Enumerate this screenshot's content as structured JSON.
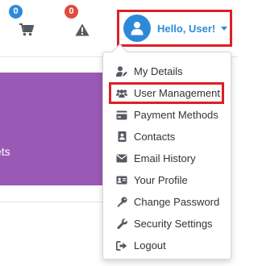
{
  "colors": {
    "accent_blue": "#2e8ad8",
    "highlight_red": "#dd1f26",
    "badge_blue": "#2e8ad8",
    "badge_red": "#e04b3a",
    "banner_purple": "#9b59b6"
  },
  "header": {
    "cart": {
      "icon": "shopping-cart-icon",
      "badge": "0"
    },
    "alerts": {
      "icon": "warning-icon",
      "badge": "0"
    },
    "user_menu": {
      "icon": "user-icon",
      "greeting": "Hello, User!",
      "caret_icon": "caret-down-icon"
    }
  },
  "background": {
    "banner_text": "kets"
  },
  "dropdown": {
    "items": [
      {
        "label": "My Details",
        "icon": "user-edit-icon"
      },
      {
        "label": "User Management",
        "icon": "users-icon",
        "highlighted": true
      },
      {
        "label": "Payment Methods",
        "icon": "credit-card-icon"
      },
      {
        "label": "Contacts",
        "icon": "address-book-icon"
      },
      {
        "label": "Email History",
        "icon": "envelope-icon"
      },
      {
        "label": "Your Profile",
        "icon": "id-card-icon"
      },
      {
        "label": "Change Password",
        "icon": "key-icon"
      },
      {
        "label": "Security Settings",
        "icon": "wrench-icon"
      },
      {
        "label": "Logout",
        "icon": "sign-out-icon"
      }
    ]
  }
}
